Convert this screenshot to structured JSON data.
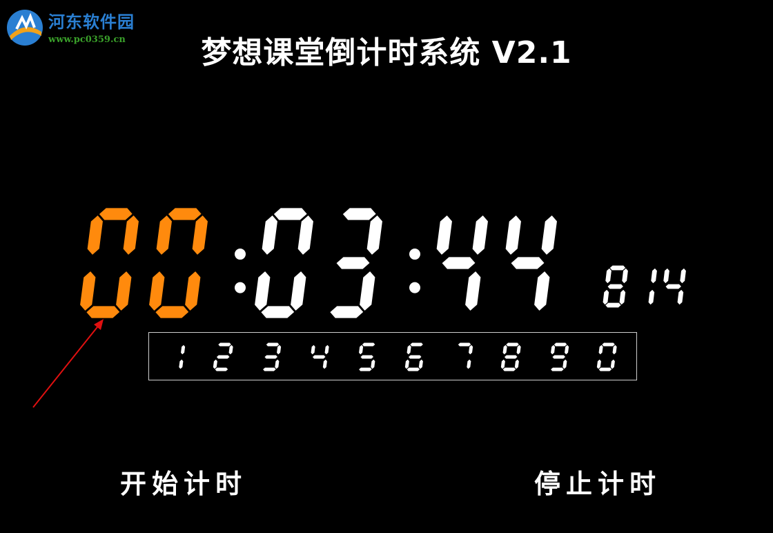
{
  "watermark": {
    "name": "河东软件园",
    "url": "www.pc0359.cn"
  },
  "app": {
    "title": "梦想课堂倒计时系统 V2.1"
  },
  "timer": {
    "hours": "00",
    "minutes": "03",
    "seconds": "44",
    "milliseconds": "814",
    "hours_color": "#ff8a0d",
    "digit_color": "#ffffff"
  },
  "keypad": {
    "digits": [
      "1",
      "2",
      "3",
      "4",
      "5",
      "6",
      "7",
      "8",
      "9",
      "0"
    ]
  },
  "buttons": {
    "start": "开始计时",
    "stop": "停止计时"
  },
  "annotation": {
    "arrow_color": "#e01010"
  }
}
